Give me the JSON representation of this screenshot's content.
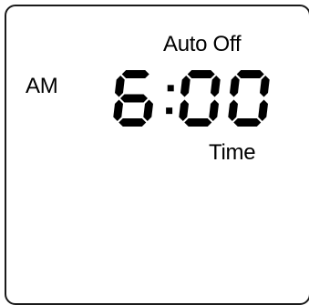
{
  "display": {
    "mode_label": "Auto Off",
    "meridiem": "AM",
    "time": "6:00",
    "field_label": "Time"
  }
}
